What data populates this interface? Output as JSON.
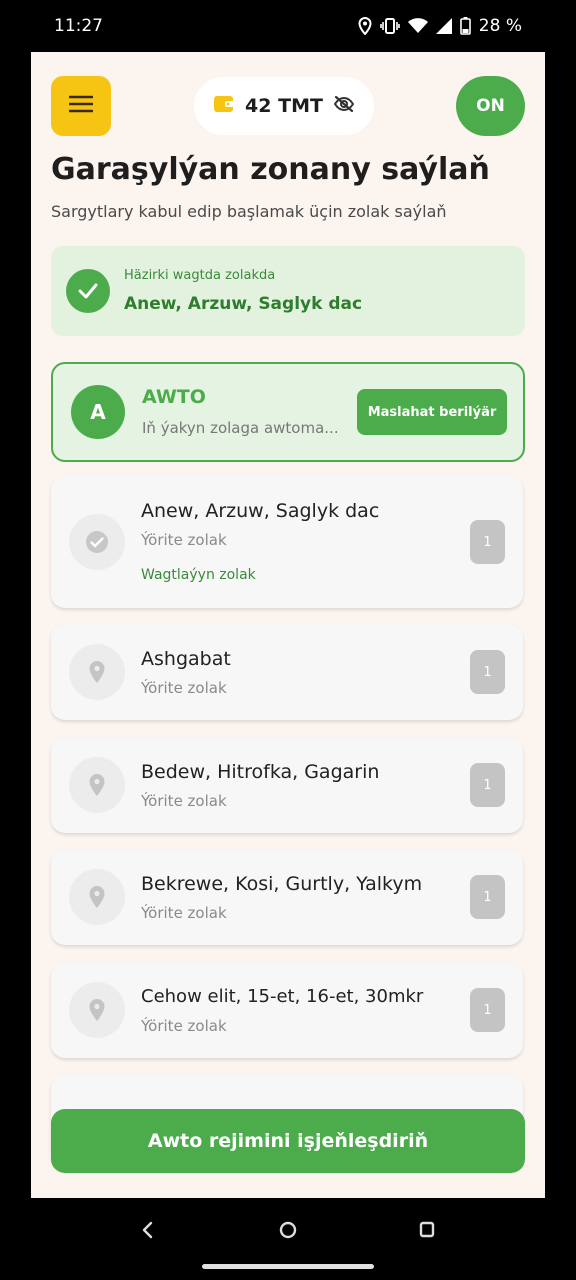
{
  "status_bar": {
    "time": "11:27",
    "battery": "28 %",
    "icons": [
      "location-icon",
      "vibrate-icon",
      "wifi-icon",
      "signal-icon",
      "battery-icon"
    ]
  },
  "header": {
    "menu_icon": "hamburger-menu-icon",
    "balance": "42 TMT",
    "wallet_icon": "wallet-icon",
    "visibility_icon": "eye-off-icon",
    "online_toggle": "ON"
  },
  "page": {
    "title": "Garaşylýan zonany saýlaň",
    "subtitle": "Sargytlary kabul edip başlamak üçin zolak saýlaň"
  },
  "current_zone": {
    "label": "Häzirki wagtda zolakda",
    "value": "Anew, Arzuw, Saglyk dac"
  },
  "auto_option": {
    "avatar_letter": "A",
    "title": "AWTO",
    "description": "Iň ýakyn zolaga awtoma...",
    "badge": "Maslahat berilýär"
  },
  "zones": [
    {
      "name": "Anew, Arzuw, Saglyk dac",
      "type": "Ýörite zolak",
      "tag": "Wagtlaýyn zolak",
      "count": "1",
      "icon": "check-circle-icon"
    },
    {
      "name": "Ashgabat",
      "type": "Ýörite zolak",
      "count": "1",
      "icon": "map-pin-icon"
    },
    {
      "name": "Bedew, Hitrofka, Gagarin",
      "type": "Ýörite zolak",
      "count": "1",
      "icon": "map-pin-icon"
    },
    {
      "name": "Bekrewe, Kosi, Gurtly, Yalkym",
      "type": "Ýörite zolak",
      "count": "1",
      "icon": "map-pin-icon"
    },
    {
      "name": "Cehow elit, 15-et, 16-et, 30mkr",
      "type": "Ýörite zolak",
      "count": "1",
      "icon": "map-pin-icon"
    }
  ],
  "bottom_button": "Awto rejimini işjeňleşdiriň",
  "colors": {
    "accent_green": "#4cac4c",
    "menu_yellow": "#f6c413",
    "background": "#fcf4ef",
    "light_green": "#e3f2df"
  }
}
